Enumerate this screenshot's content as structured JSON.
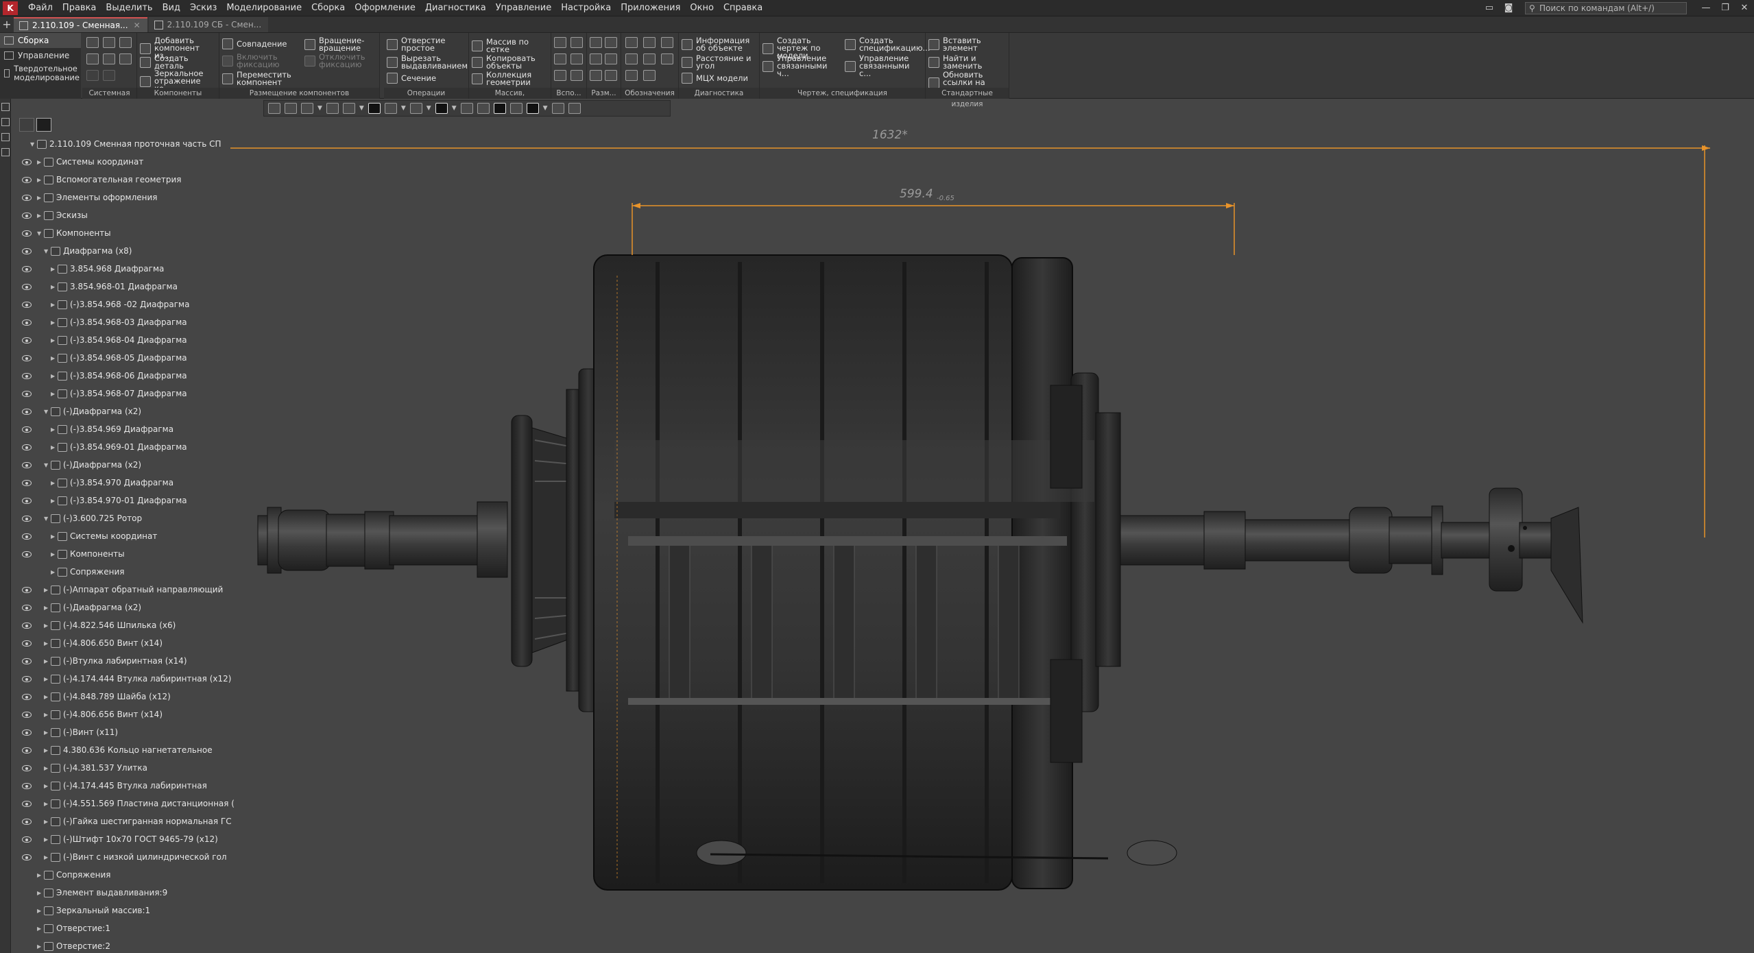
{
  "menu": [
    "Файл",
    "Правка",
    "Выделить",
    "Вид",
    "Эскиз",
    "Моделирование",
    "Сборка",
    "Оформление",
    "Диагностика",
    "Управление",
    "Настройка",
    "Приложения",
    "Окно",
    "Справка"
  ],
  "search": {
    "placeholder": "Поиск по командам (Alt+/)"
  },
  "tabs": [
    {
      "label": "2.110.109 - Сменная...",
      "active": true
    },
    {
      "label": "2.110.109 СБ - Смен...",
      "active": false
    }
  ],
  "modes": [
    "Сборка",
    "Управление",
    "Твердотельное моделирование"
  ],
  "ribbon": {
    "groups": [
      "Системная",
      "Компоненты",
      "Размещение компонентов",
      "Операции",
      "Массив, копирование",
      "Вспо...",
      "Разм...",
      "Обозначения",
      "Диагностика",
      "Чертеж, спецификация",
      "Стандартные изделия"
    ],
    "buttons": {
      "add_component": "Добавить компонент из...",
      "create_part": "Создать деталь",
      "mirror": "Зеркальное отражение ко...",
      "coincide": "Совпадение",
      "enable_fix": "Включить фиксацию",
      "move": "Переместить компонент",
      "rotate": "Вращение-вращение",
      "disable_fix": "Отключить фиксацию",
      "simple_hole": "Отверстие простое",
      "cut_extrude": "Вырезать выдавливанием",
      "section": "Сечение",
      "grid_array": "Массив по сетке",
      "copy_objects": "Копировать объекты",
      "geometry_collection": "Коллекция геометрии",
      "object_info": "Информация об объекте",
      "distance_angle": "Расстояние и угол",
      "mass_props": "МЦХ модели",
      "create_drawing": "Создать чертеж по модели",
      "manage_linked": "Управление связанными ч...",
      "create_spec": "Создать спецификацию...",
      "manage_linked_s": "Управление связанными с...",
      "insert_element": "Вставить элемент",
      "find_replace": "Найти и заменить",
      "update_links": "Обновить ссылки на мод..."
    }
  },
  "tree": [
    {
      "depth": 0,
      "label": "2.110.109 Сменная проточная часть СП",
      "expanded": true,
      "eye": false
    },
    {
      "depth": 1,
      "label": "Системы координат",
      "expanded": false,
      "eye": true
    },
    {
      "depth": 1,
      "label": "Вспомогательная геометрия",
      "expanded": false,
      "eye": true
    },
    {
      "depth": 1,
      "label": "Элементы оформления",
      "expanded": false,
      "eye": true
    },
    {
      "depth": 1,
      "label": "Эскизы",
      "expanded": false,
      "eye": true
    },
    {
      "depth": 1,
      "label": "Компоненты",
      "expanded": true,
      "eye": true
    },
    {
      "depth": 2,
      "label": "Диафрагма (x8)",
      "expanded": true,
      "eye": true
    },
    {
      "depth": 3,
      "label": "3.854.968 Диафрагма",
      "expanded": false,
      "eye": true
    },
    {
      "depth": 3,
      "label": "3.854.968-01 Диафрагма",
      "expanded": false,
      "eye": true
    },
    {
      "depth": 3,
      "label": "(-)3.854.968 -02 Диафрагма",
      "expanded": false,
      "eye": true
    },
    {
      "depth": 3,
      "label": "(-)3.854.968-03 Диафрагма",
      "expanded": false,
      "eye": true
    },
    {
      "depth": 3,
      "label": "(-)3.854.968-04 Диафрагма",
      "expanded": false,
      "eye": true
    },
    {
      "depth": 3,
      "label": "(-)3.854.968-05 Диафрагма",
      "expanded": false,
      "eye": true
    },
    {
      "depth": 3,
      "label": "(-)3.854.968-06 Диафрагма",
      "expanded": false,
      "eye": true
    },
    {
      "depth": 3,
      "label": "(-)3.854.968-07 Диафрагма",
      "expanded": false,
      "eye": true
    },
    {
      "depth": 2,
      "label": "(-)Диафрагма (x2)",
      "expanded": true,
      "eye": true
    },
    {
      "depth": 3,
      "label": "(-)3.854.969 Диафрагма",
      "expanded": false,
      "eye": true
    },
    {
      "depth": 3,
      "label": "(-)3.854.969-01 Диафрагма",
      "expanded": false,
      "eye": true
    },
    {
      "depth": 2,
      "label": "(-)Диафрагма (x2)",
      "expanded": true,
      "eye": true
    },
    {
      "depth": 3,
      "label": "(-)3.854.970 Диафрагма",
      "expanded": false,
      "eye": true
    },
    {
      "depth": 3,
      "label": "(-)3.854.970-01 Диафрагма",
      "expanded": false,
      "eye": true
    },
    {
      "depth": 2,
      "label": "(-)3.600.725 Ротор",
      "expanded": true,
      "eye": true
    },
    {
      "depth": 3,
      "label": "Системы координат",
      "expanded": false,
      "eye": true
    },
    {
      "depth": 3,
      "label": "Компоненты",
      "expanded": false,
      "eye": true
    },
    {
      "depth": 3,
      "label": "Сопряжения",
      "expanded": false,
      "eye": false
    },
    {
      "depth": 2,
      "label": "(-)Аппарат обратный направляющий",
      "expanded": false,
      "eye": true
    },
    {
      "depth": 2,
      "label": "(-)Диафрагма (x2)",
      "expanded": false,
      "eye": true
    },
    {
      "depth": 2,
      "label": "(-)4.822.546 Шпилька (x6)",
      "expanded": false,
      "eye": true
    },
    {
      "depth": 2,
      "label": "(-)4.806.650 Винт (x14)",
      "expanded": false,
      "eye": true
    },
    {
      "depth": 2,
      "label": "(-)Втулка лабиринтная (x14)",
      "expanded": false,
      "eye": true
    },
    {
      "depth": 2,
      "label": "(-)4.174.444 Втулка лабиринтная (x12)",
      "expanded": false,
      "eye": true
    },
    {
      "depth": 2,
      "label": "(-)4.848.789 Шайба (x12)",
      "expanded": false,
      "eye": true
    },
    {
      "depth": 2,
      "label": "(-)4.806.656 Винт (x14)",
      "expanded": false,
      "eye": true
    },
    {
      "depth": 2,
      "label": "(-)Винт (x11)",
      "expanded": false,
      "eye": true
    },
    {
      "depth": 2,
      "label": "4.380.636 Кольцо нагнетательное",
      "expanded": false,
      "eye": true
    },
    {
      "depth": 2,
      "label": "(-)4.381.537 Улитка",
      "expanded": false,
      "eye": true
    },
    {
      "depth": 2,
      "label": "(-)4.174.445 Втулка лабиринтная",
      "expanded": false,
      "eye": true
    },
    {
      "depth": 2,
      "label": "(-)4.551.569 Пластина дистанционная (",
      "expanded": false,
      "eye": true
    },
    {
      "depth": 2,
      "label": "(-)Гайка шестигранная нормальная ГС",
      "expanded": false,
      "eye": true
    },
    {
      "depth": 2,
      "label": "(-)Штифт 10х70 ГОСТ 9465-79 (x12)",
      "expanded": false,
      "eye": true
    },
    {
      "depth": 2,
      "label": "(-)Винт с низкой цилиндрической гол",
      "expanded": false,
      "eye": true
    },
    {
      "depth": 1,
      "label": "Сопряжения",
      "expanded": false,
      "eye": false
    },
    {
      "depth": 1,
      "label": "Элемент выдавливания:9",
      "expanded": false,
      "eye": false
    },
    {
      "depth": 1,
      "label": "Зеркальный массив:1",
      "expanded": false,
      "eye": false
    },
    {
      "depth": 1,
      "label": "Отверстие:1",
      "expanded": false,
      "eye": false
    },
    {
      "depth": 1,
      "label": "Отверстие:2",
      "expanded": false,
      "eye": false
    }
  ],
  "viewport": {
    "dimensions": [
      {
        "value": "1632*"
      },
      {
        "value": "599.4",
        "tolerance": "-0.65"
      }
    ],
    "dim_color": "#e8932a"
  },
  "colors": {
    "accent": "#b3262c",
    "background": "#454545",
    "panel": "#393939"
  }
}
